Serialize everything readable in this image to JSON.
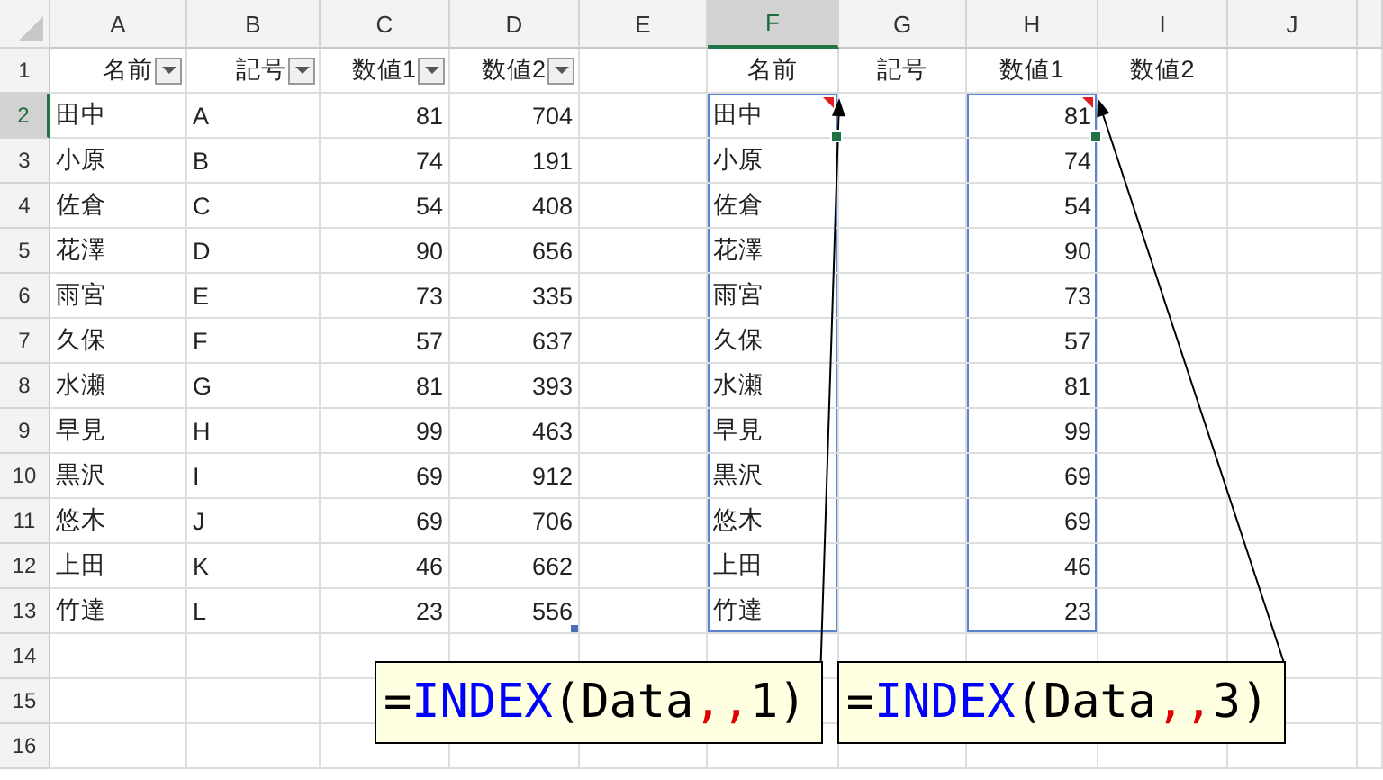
{
  "columns": [
    {
      "label": "A",
      "kind": "text",
      "selected": false
    },
    {
      "label": "B",
      "kind": "text",
      "selected": false
    },
    {
      "label": "C",
      "kind": "number",
      "selected": false
    },
    {
      "label": "D",
      "kind": "number",
      "selected": false
    },
    {
      "label": "E",
      "kind": "text",
      "selected": false
    },
    {
      "label": "F",
      "kind": "text",
      "selected": true
    },
    {
      "label": "G",
      "kind": "text",
      "selected": false
    },
    {
      "label": "H",
      "kind": "number",
      "selected": false
    },
    {
      "label": "I",
      "kind": "text",
      "selected": false
    },
    {
      "label": "J",
      "kind": "text",
      "selected": false
    }
  ],
  "rows": [
    {
      "header": "1",
      "selected": false,
      "kind": "header",
      "cells": [
        {
          "text": "名前",
          "filter": true
        },
        {
          "text": "記号",
          "filter": true
        },
        {
          "text": "数値1",
          "filter": true
        },
        {
          "text": "数値2",
          "filter": true
        },
        null,
        {
          "text": "名前"
        },
        {
          "text": "記号"
        },
        {
          "text": "数値1"
        },
        {
          "text": "数値2"
        },
        null
      ]
    },
    {
      "header": "2",
      "selected": true,
      "kind": "data",
      "cells": [
        {
          "text": "田中"
        },
        {
          "text": "A"
        },
        {
          "text": "81"
        },
        {
          "text": "704"
        },
        null,
        {
          "text": "田中",
          "selected": true,
          "comment": true,
          "spill": true,
          "arrow": true
        },
        null,
        {
          "text": "81",
          "selected": true,
          "comment": true,
          "spill": true,
          "arrow": true
        },
        null,
        null
      ]
    },
    {
      "header": "3",
      "selected": false,
      "kind": "data",
      "cells": [
        {
          "text": "小原"
        },
        {
          "text": "B"
        },
        {
          "text": "74"
        },
        {
          "text": "191"
        },
        null,
        {
          "text": "小原",
          "spill": true
        },
        null,
        {
          "text": "74",
          "spill": true
        },
        null,
        null
      ]
    },
    {
      "header": "4",
      "selected": false,
      "kind": "data",
      "cells": [
        {
          "text": "佐倉"
        },
        {
          "text": "C"
        },
        {
          "text": "54"
        },
        {
          "text": "408"
        },
        null,
        {
          "text": "佐倉",
          "spill": true
        },
        null,
        {
          "text": "54",
          "spill": true
        },
        null,
        null
      ]
    },
    {
      "header": "5",
      "selected": false,
      "kind": "data",
      "cells": [
        {
          "text": "花澤"
        },
        {
          "text": "D"
        },
        {
          "text": "90"
        },
        {
          "text": "656"
        },
        null,
        {
          "text": "花澤",
          "spill": true
        },
        null,
        {
          "text": "90",
          "spill": true
        },
        null,
        null
      ]
    },
    {
      "header": "6",
      "selected": false,
      "kind": "data",
      "cells": [
        {
          "text": "雨宮"
        },
        {
          "text": "E"
        },
        {
          "text": "73"
        },
        {
          "text": "335"
        },
        null,
        {
          "text": "雨宮",
          "spill": true
        },
        null,
        {
          "text": "73",
          "spill": true
        },
        null,
        null
      ]
    },
    {
      "header": "7",
      "selected": false,
      "kind": "data",
      "cells": [
        {
          "text": "久保"
        },
        {
          "text": "F"
        },
        {
          "text": "57"
        },
        {
          "text": "637"
        },
        null,
        {
          "text": "久保",
          "spill": true
        },
        null,
        {
          "text": "57",
          "spill": true
        },
        null,
        null
      ]
    },
    {
      "header": "8",
      "selected": false,
      "kind": "data",
      "cells": [
        {
          "text": "水瀬"
        },
        {
          "text": "G"
        },
        {
          "text": "81"
        },
        {
          "text": "393"
        },
        null,
        {
          "text": "水瀬",
          "spill": true
        },
        null,
        {
          "text": "81",
          "spill": true
        },
        null,
        null
      ]
    },
    {
      "header": "9",
      "selected": false,
      "kind": "data",
      "cells": [
        {
          "text": "早見"
        },
        {
          "text": "H"
        },
        {
          "text": "99"
        },
        {
          "text": "463"
        },
        null,
        {
          "text": "早見",
          "spill": true
        },
        null,
        {
          "text": "99",
          "spill": true
        },
        null,
        null
      ]
    },
    {
      "header": "10",
      "selected": false,
      "kind": "data",
      "cells": [
        {
          "text": "黒沢"
        },
        {
          "text": "I"
        },
        {
          "text": "69"
        },
        {
          "text": "912"
        },
        null,
        {
          "text": "黒沢",
          "spill": true
        },
        null,
        {
          "text": "69",
          "spill": true
        },
        null,
        null
      ]
    },
    {
      "header": "11",
      "selected": false,
      "kind": "data",
      "cells": [
        {
          "text": "悠木"
        },
        {
          "text": "J"
        },
        {
          "text": "69"
        },
        {
          "text": "706"
        },
        null,
        {
          "text": "悠木",
          "spill": true
        },
        null,
        {
          "text": "69",
          "spill": true
        },
        null,
        null
      ]
    },
    {
      "header": "12",
      "selected": false,
      "kind": "data",
      "cells": [
        {
          "text": "上田"
        },
        {
          "text": "K"
        },
        {
          "text": "46"
        },
        {
          "text": "662"
        },
        null,
        {
          "text": "上田",
          "spill": true
        },
        null,
        {
          "text": "46",
          "spill": true
        },
        null,
        null
      ]
    },
    {
      "header": "13",
      "selected": false,
      "kind": "data",
      "cells": [
        {
          "text": "竹達"
        },
        {
          "text": "L"
        },
        {
          "text": "23"
        },
        {
          "text": "556",
          "handle": true
        },
        null,
        {
          "text": "竹達",
          "spill": true
        },
        null,
        {
          "text": "23",
          "spill": true
        },
        null,
        null
      ]
    },
    {
      "header": "14",
      "selected": false,
      "kind": "data"
    },
    {
      "header": "15",
      "selected": false,
      "kind": "data"
    },
    {
      "header": "16",
      "selected": false,
      "kind": "data"
    }
  ],
  "callouts": [
    {
      "segments": [
        {
          "text": "=",
          "kind": "plain"
        },
        {
          "text": "INDEX",
          "kind": "function"
        },
        {
          "text": "(Data",
          "kind": "plain"
        },
        {
          "text": ",,",
          "kind": "separator"
        },
        {
          "text": "1)",
          "kind": "plain"
        }
      ]
    },
    {
      "segments": [
        {
          "text": "=",
          "kind": "plain"
        },
        {
          "text": "INDEX",
          "kind": "function"
        },
        {
          "text": "(Data",
          "kind": "plain"
        },
        {
          "text": ",,",
          "kind": "separator"
        },
        {
          "text": "3)",
          "kind": "plain"
        }
      ]
    }
  ]
}
